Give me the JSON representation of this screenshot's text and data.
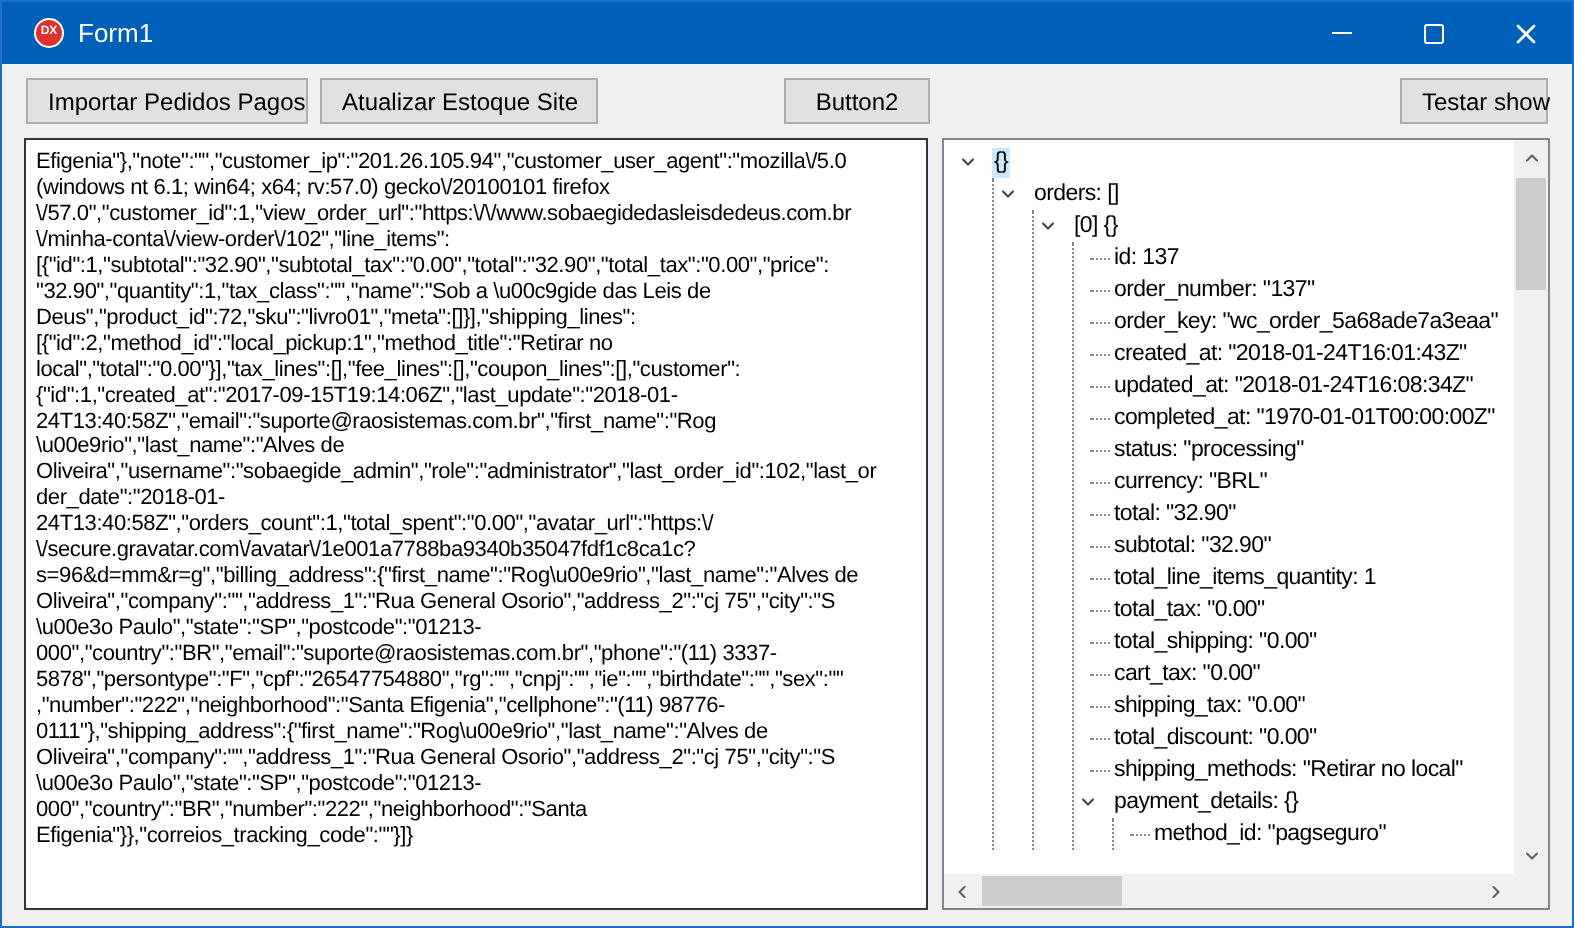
{
  "window": {
    "title": "Form1",
    "app_icon": "DX"
  },
  "buttons": [
    {
      "label": "Importar Pedidos Pagos"
    },
    {
      "label": "Atualizar Estoque Site"
    },
    {
      "label": "Button2"
    },
    {
      "label": "Testar show"
    }
  ],
  "memo": {
    "lines": [
      "Efigenia\"},\"note\":\"\",\"customer_ip\":\"201.26.105.94\",\"customer_user_agent\":\"mozilla\\/5.0",
      "(windows nt 6.1; win64; x64; rv:57.0) gecko\\/20100101 firefox",
      "\\/57.0\",\"customer_id\":1,\"view_order_url\":\"https:\\/\\/www.sobaegidedasleisdedeus.com.br",
      "\\/minha-conta\\/view-order\\/102\",\"line_items\":",
      "[{\"id\":1,\"subtotal\":\"32.90\",\"subtotal_tax\":\"0.00\",\"total\":\"32.90\",\"total_tax\":\"0.00\",\"price\":",
      "\"32.90\",\"quantity\":1,\"tax_class\":\"\",\"name\":\"Sob a \\u00c9gide das Leis de",
      "Deus\",\"product_id\":72,\"sku\":\"livro01\",\"meta\":[]}],\"shipping_lines\":",
      "[{\"id\":2,\"method_id\":\"local_pickup:1\",\"method_title\":\"Retirar no",
      "local\",\"total\":\"0.00\"}],\"tax_lines\":[],\"fee_lines\":[],\"coupon_lines\":[],\"customer\":",
      "{\"id\":1,\"created_at\":\"2017-09-15T19:14:06Z\",\"last_update\":\"2018-01-",
      "24T13:40:58Z\",\"email\":\"suporte@raosistemas.com.br\",\"first_name\":\"Rog",
      "\\u00e9rio\",\"last_name\":\"Alves de",
      "Oliveira\",\"username\":\"sobaegide_admin\",\"role\":\"administrator\",\"last_order_id\":102,\"last_or",
      "der_date\":\"2018-01-",
      "24T13:40:58Z\",\"orders_count\":1,\"total_spent\":\"0.00\",\"avatar_url\":\"https:\\/",
      "\\/secure.gravatar.com\\/avatar\\/1e001a7788ba9340b35047fdf1c8ca1c?",
      "s=96&d=mm&r=g\",\"billing_address\":{\"first_name\":\"Rog\\u00e9rio\",\"last_name\":\"Alves de",
      "Oliveira\",\"company\":\"\",\"address_1\":\"Rua General Osorio\",\"address_2\":\"cj 75\",\"city\":\"S",
      "\\u00e3o Paulo\",\"state\":\"SP\",\"postcode\":\"01213-",
      "000\",\"country\":\"BR\",\"email\":\"suporte@raosistemas.com.br\",\"phone\":\"(11) 3337-",
      "5878\",\"persontype\":\"F\",\"cpf\":\"26547754880\",\"rg\":\"\",\"cnpj\":\"\",\"ie\":\"\",\"birthdate\":\"\",\"sex\":\"\"",
      ",\"number\":\"222\",\"neighborhood\":\"Santa Efigenia\",\"cellphone\":\"(11) 98776-",
      "0111\"},\"shipping_address\":{\"first_name\":\"Rog\\u00e9rio\",\"last_name\":\"Alves de",
      "Oliveira\",\"company\":\"\",\"address_1\":\"Rua General Osorio\",\"address_2\":\"cj 75\",\"city\":\"S",
      "\\u00e3o Paulo\",\"state\":\"SP\",\"postcode\":\"01213-",
      "000\",\"country\":\"BR\",\"number\":\"222\",\"neighborhood\":\"Santa",
      "Efigenia\"}},\"correios_tracking_code\":\"\"}]}"
    ]
  },
  "tree": {
    "nodes": [
      {
        "label": "{}",
        "selected": true,
        "expanded": true,
        "children": [
          {
            "label": "orders: []",
            "selected": false,
            "expanded": true,
            "children": [
              {
                "label": "[0] {}",
                "selected": false,
                "expanded": true,
                "children": [
                  {
                    "label": "id: 137",
                    "selected": false
                  },
                  {
                    "label": "order_number: \"137\"",
                    "selected": false
                  },
                  {
                    "label": "order_key: \"wc_order_5a68ade7a3eaa\"",
                    "selected": false
                  },
                  {
                    "label": "created_at: \"2018-01-24T16:01:43Z\"",
                    "selected": false
                  },
                  {
                    "label": "updated_at: \"2018-01-24T16:08:34Z\"",
                    "selected": false
                  },
                  {
                    "label": "completed_at: \"1970-01-01T00:00:00Z\"",
                    "selected": false
                  },
                  {
                    "label": "status: \"processing\"",
                    "selected": false
                  },
                  {
                    "label": "currency: \"BRL\"",
                    "selected": false
                  },
                  {
                    "label": "total: \"32.90\"",
                    "selected": false
                  },
                  {
                    "label": "subtotal: \"32.90\"",
                    "selected": false
                  },
                  {
                    "label": "total_line_items_quantity: 1",
                    "selected": false
                  },
                  {
                    "label": "total_tax: \"0.00\"",
                    "selected": false
                  },
                  {
                    "label": "total_shipping: \"0.00\"",
                    "selected": false
                  },
                  {
                    "label": "cart_tax: \"0.00\"",
                    "selected": false
                  },
                  {
                    "label": "shipping_tax: \"0.00\"",
                    "selected": false
                  },
                  {
                    "label": "total_discount: \"0.00\"",
                    "selected": false
                  },
                  {
                    "label": "shipping_methods: \"Retirar no local\"",
                    "selected": false
                  },
                  {
                    "label": "payment_details: {}",
                    "selected": false,
                    "expanded": true,
                    "children": [
                      {
                        "label": "method_id: \"pagseguro\"",
                        "selected": false
                      }
                    ]
                  }
                ]
              }
            ]
          }
        ]
      }
    ]
  }
}
